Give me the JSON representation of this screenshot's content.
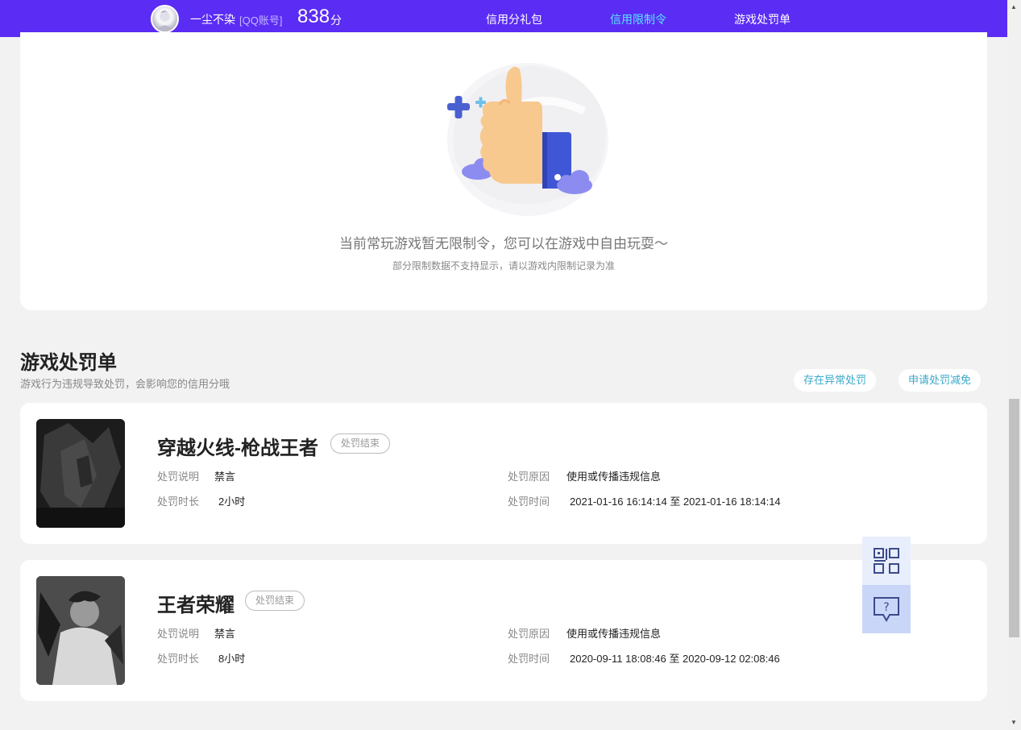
{
  "header": {
    "username": "一尘不染",
    "account_tag": "[QQ账号]",
    "score": "838",
    "score_unit": "分",
    "tabs": [
      {
        "label": "信用分礼包"
      },
      {
        "label": "信用限制令"
      },
      {
        "label": "游戏处罚单"
      }
    ],
    "active_tab": "信用限制令",
    "active_color": "#59e6ff",
    "bar_color": "#5b2cf4"
  },
  "restriction": {
    "empty_title": "当前常玩游戏暂无限制令，您可以在游戏中自由玩耍～",
    "empty_subtitle": "部分限制数据不支持显示，请以游戏内限制记录为准"
  },
  "penalty_section": {
    "title": "游戏处罚单",
    "subtitle": "游戏行为违规导致处罚，会影响您的信用分哦",
    "buttons": [
      {
        "label": "存在异常处罚"
      },
      {
        "label": "申请处罚减免"
      }
    ],
    "field_labels": {
      "description": "处罚说明",
      "duration": "处罚时长",
      "reason": "处罚原因",
      "time": "处罚时间"
    },
    "items": [
      {
        "game": "穿越火线-枪战王者",
        "status": "处罚结束",
        "description": "禁言",
        "duration": "2小时",
        "reason": "使用或传播违规信息",
        "time": "2021-01-16 16:14:14 至 2021-01-16 18:14:14"
      },
      {
        "game": "王者荣耀",
        "status": "处罚结束",
        "description": "禁言",
        "duration": "8小时",
        "reason": "使用或传播违规信息",
        "time": "2020-09-11 18:08:46 至 2020-09-12 02:08:46"
      }
    ]
  },
  "floating": {
    "qr_icon": "qr-code-icon",
    "help_icon": "help-chat-icon"
  }
}
